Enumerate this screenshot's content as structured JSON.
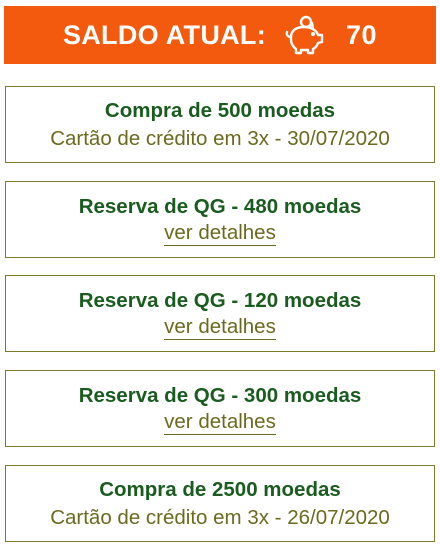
{
  "balance": {
    "label": "SALDO ATUAL:",
    "icon": "piggy-bank-icon",
    "value": "70",
    "color": "#f45a0d"
  },
  "transactions": [
    {
      "title": "Compra de 500 moedas",
      "subtitle": "Cartão de crédito em 3x - 30/07/2020"
    },
    {
      "title": "Reserva de QG - 480 moedas",
      "link": "ver detalhes"
    },
    {
      "title": "Reserva de QG - 120 moedas",
      "link": "ver detalhes"
    },
    {
      "title": "Reserva de QG - 300 moedas",
      "link": "ver detalhes"
    },
    {
      "title": "Compra de 2500 moedas",
      "subtitle": "Cartão de crédito em 3x - 26/07/2020"
    }
  ],
  "colors": {
    "title": "#1a5c1f",
    "subtitle": "#6b6a1f",
    "border": "#7d7a2a"
  }
}
